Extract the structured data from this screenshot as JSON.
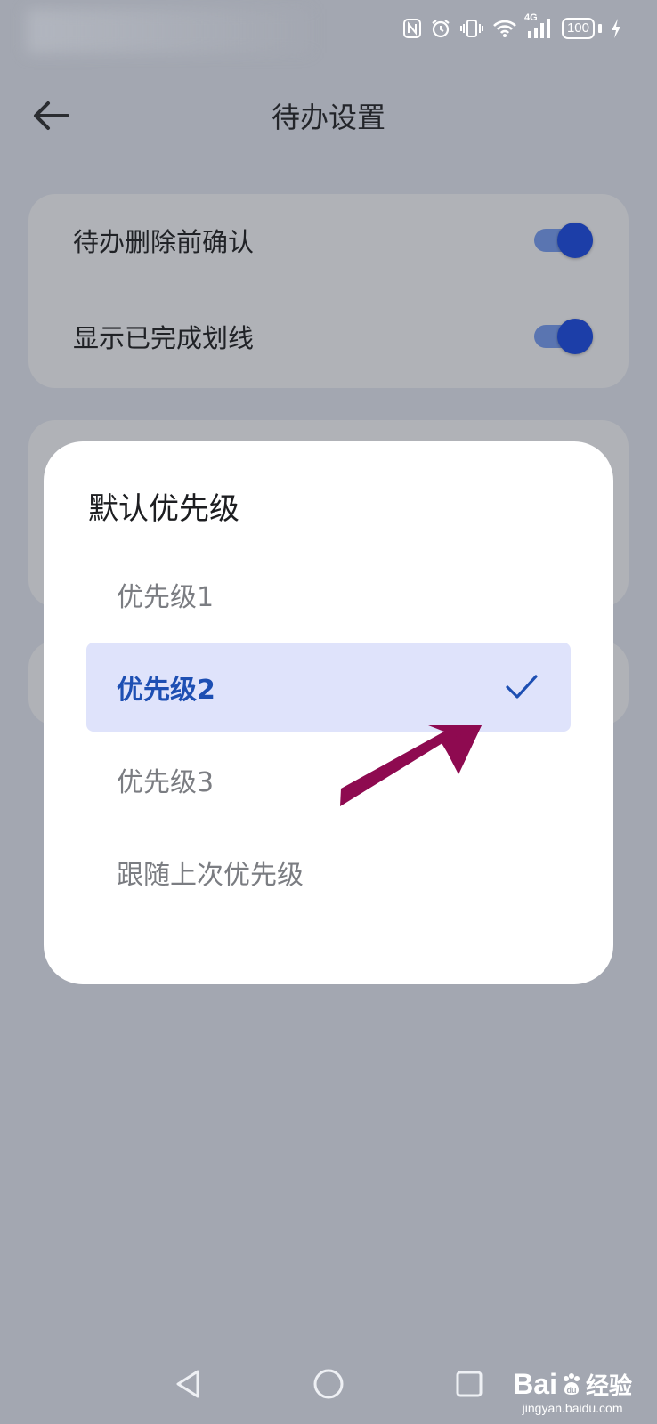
{
  "status_bar": {
    "network_label": "4G",
    "battery_level": "100",
    "icons": [
      "nfc-icon",
      "alarm-icon",
      "vibrate-icon",
      "wifi-icon",
      "signal-icon",
      "battery-icon",
      "charging-icon"
    ]
  },
  "header": {
    "title": "待办设置",
    "back_icon": "back-arrow-icon"
  },
  "settings": [
    {
      "label": "待办删除前确认",
      "enabled": true
    },
    {
      "label": "显示已完成划线",
      "enabled": true
    }
  ],
  "dialog": {
    "title": "默认优先级",
    "options": [
      {
        "label": "优先级1",
        "selected": false
      },
      {
        "label": "优先级2",
        "selected": true
      },
      {
        "label": "优先级3",
        "selected": false
      },
      {
        "label": "跟随上次优先级",
        "selected": false
      }
    ]
  },
  "annotation": {
    "color": "#8e0a50"
  },
  "colors": {
    "accent": "#1d4fb3",
    "selected_bg": "#dfe3fb",
    "toggle_on": "#1c3ea8",
    "overlay_bg": "#a3a7b1"
  },
  "nav_bar": {
    "icons": [
      "back-triangle-icon",
      "home-circle-icon",
      "recents-square-icon"
    ]
  },
  "watermark": {
    "brand": "Bai",
    "brand_suffix": "经验",
    "url": "jingyan.baidu.com"
  }
}
